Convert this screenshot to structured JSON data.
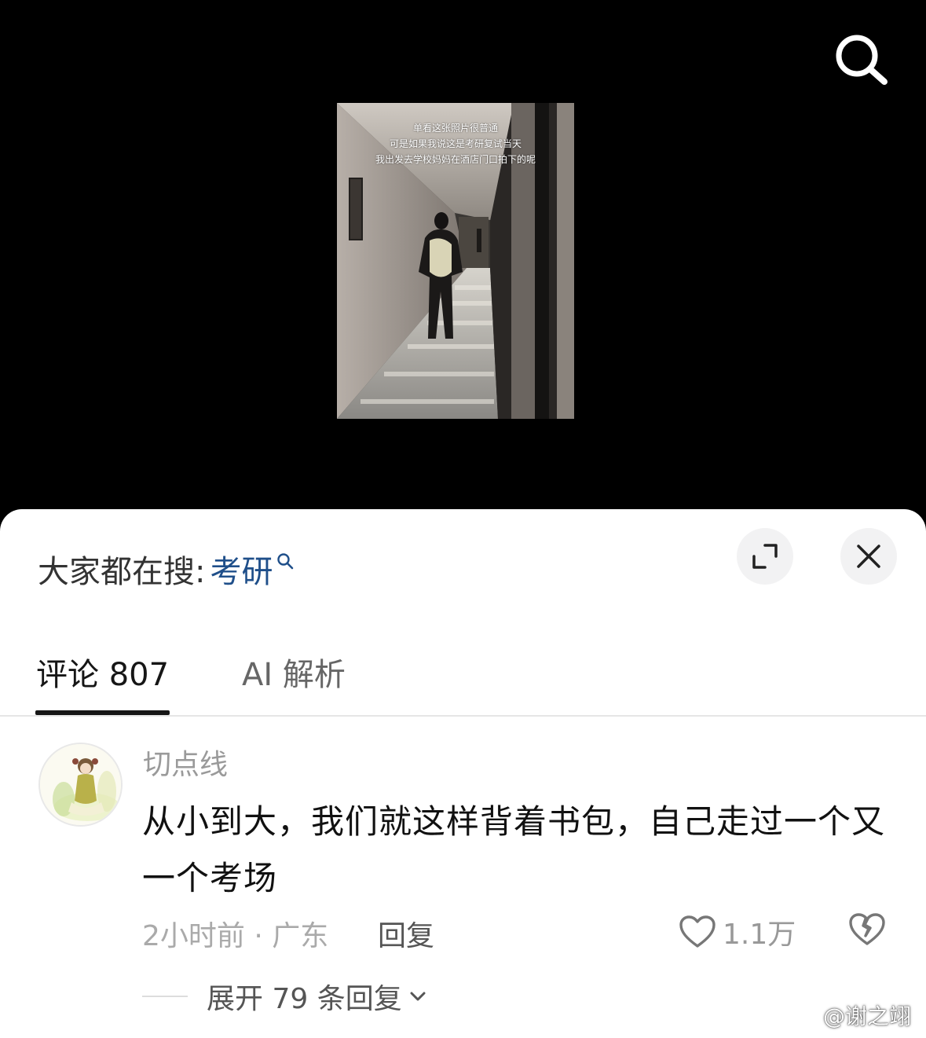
{
  "video": {
    "caption_lines": [
      "单看这张照片很普通",
      "可是如果我说这是考研复试当天",
      "我出发去学校妈妈在酒店门口拍下的呢"
    ]
  },
  "header": {
    "search_icon": "search-icon"
  },
  "sheet": {
    "hot_search_label": "大家都在搜:",
    "hot_search_term": "考研",
    "expand_icon": "expand-icon",
    "close_icon": "close-icon"
  },
  "tabs": [
    {
      "label": "评论 807",
      "active": true
    },
    {
      "label": "AI 解析",
      "active": false
    }
  ],
  "comment": {
    "username": "切点线",
    "text": "从小到大，我们就这样背着书包，自己走过一个又一个考场",
    "meta": "2小时前 · 广东",
    "reply_label": "回复",
    "like_count": "1.1万",
    "like_icon": "heart-icon",
    "dislike_icon": "broken-heart-icon",
    "expand_replies_label": "展开 79 条回复"
  },
  "watermark": {
    "text": "@谢之翊"
  },
  "colors": {
    "video_bg": "#000000",
    "sheet_bg": "#ffffff",
    "hot_term": "#1f4f8a",
    "primary_text": "#111111",
    "secondary_text": "#9a9a9a"
  }
}
